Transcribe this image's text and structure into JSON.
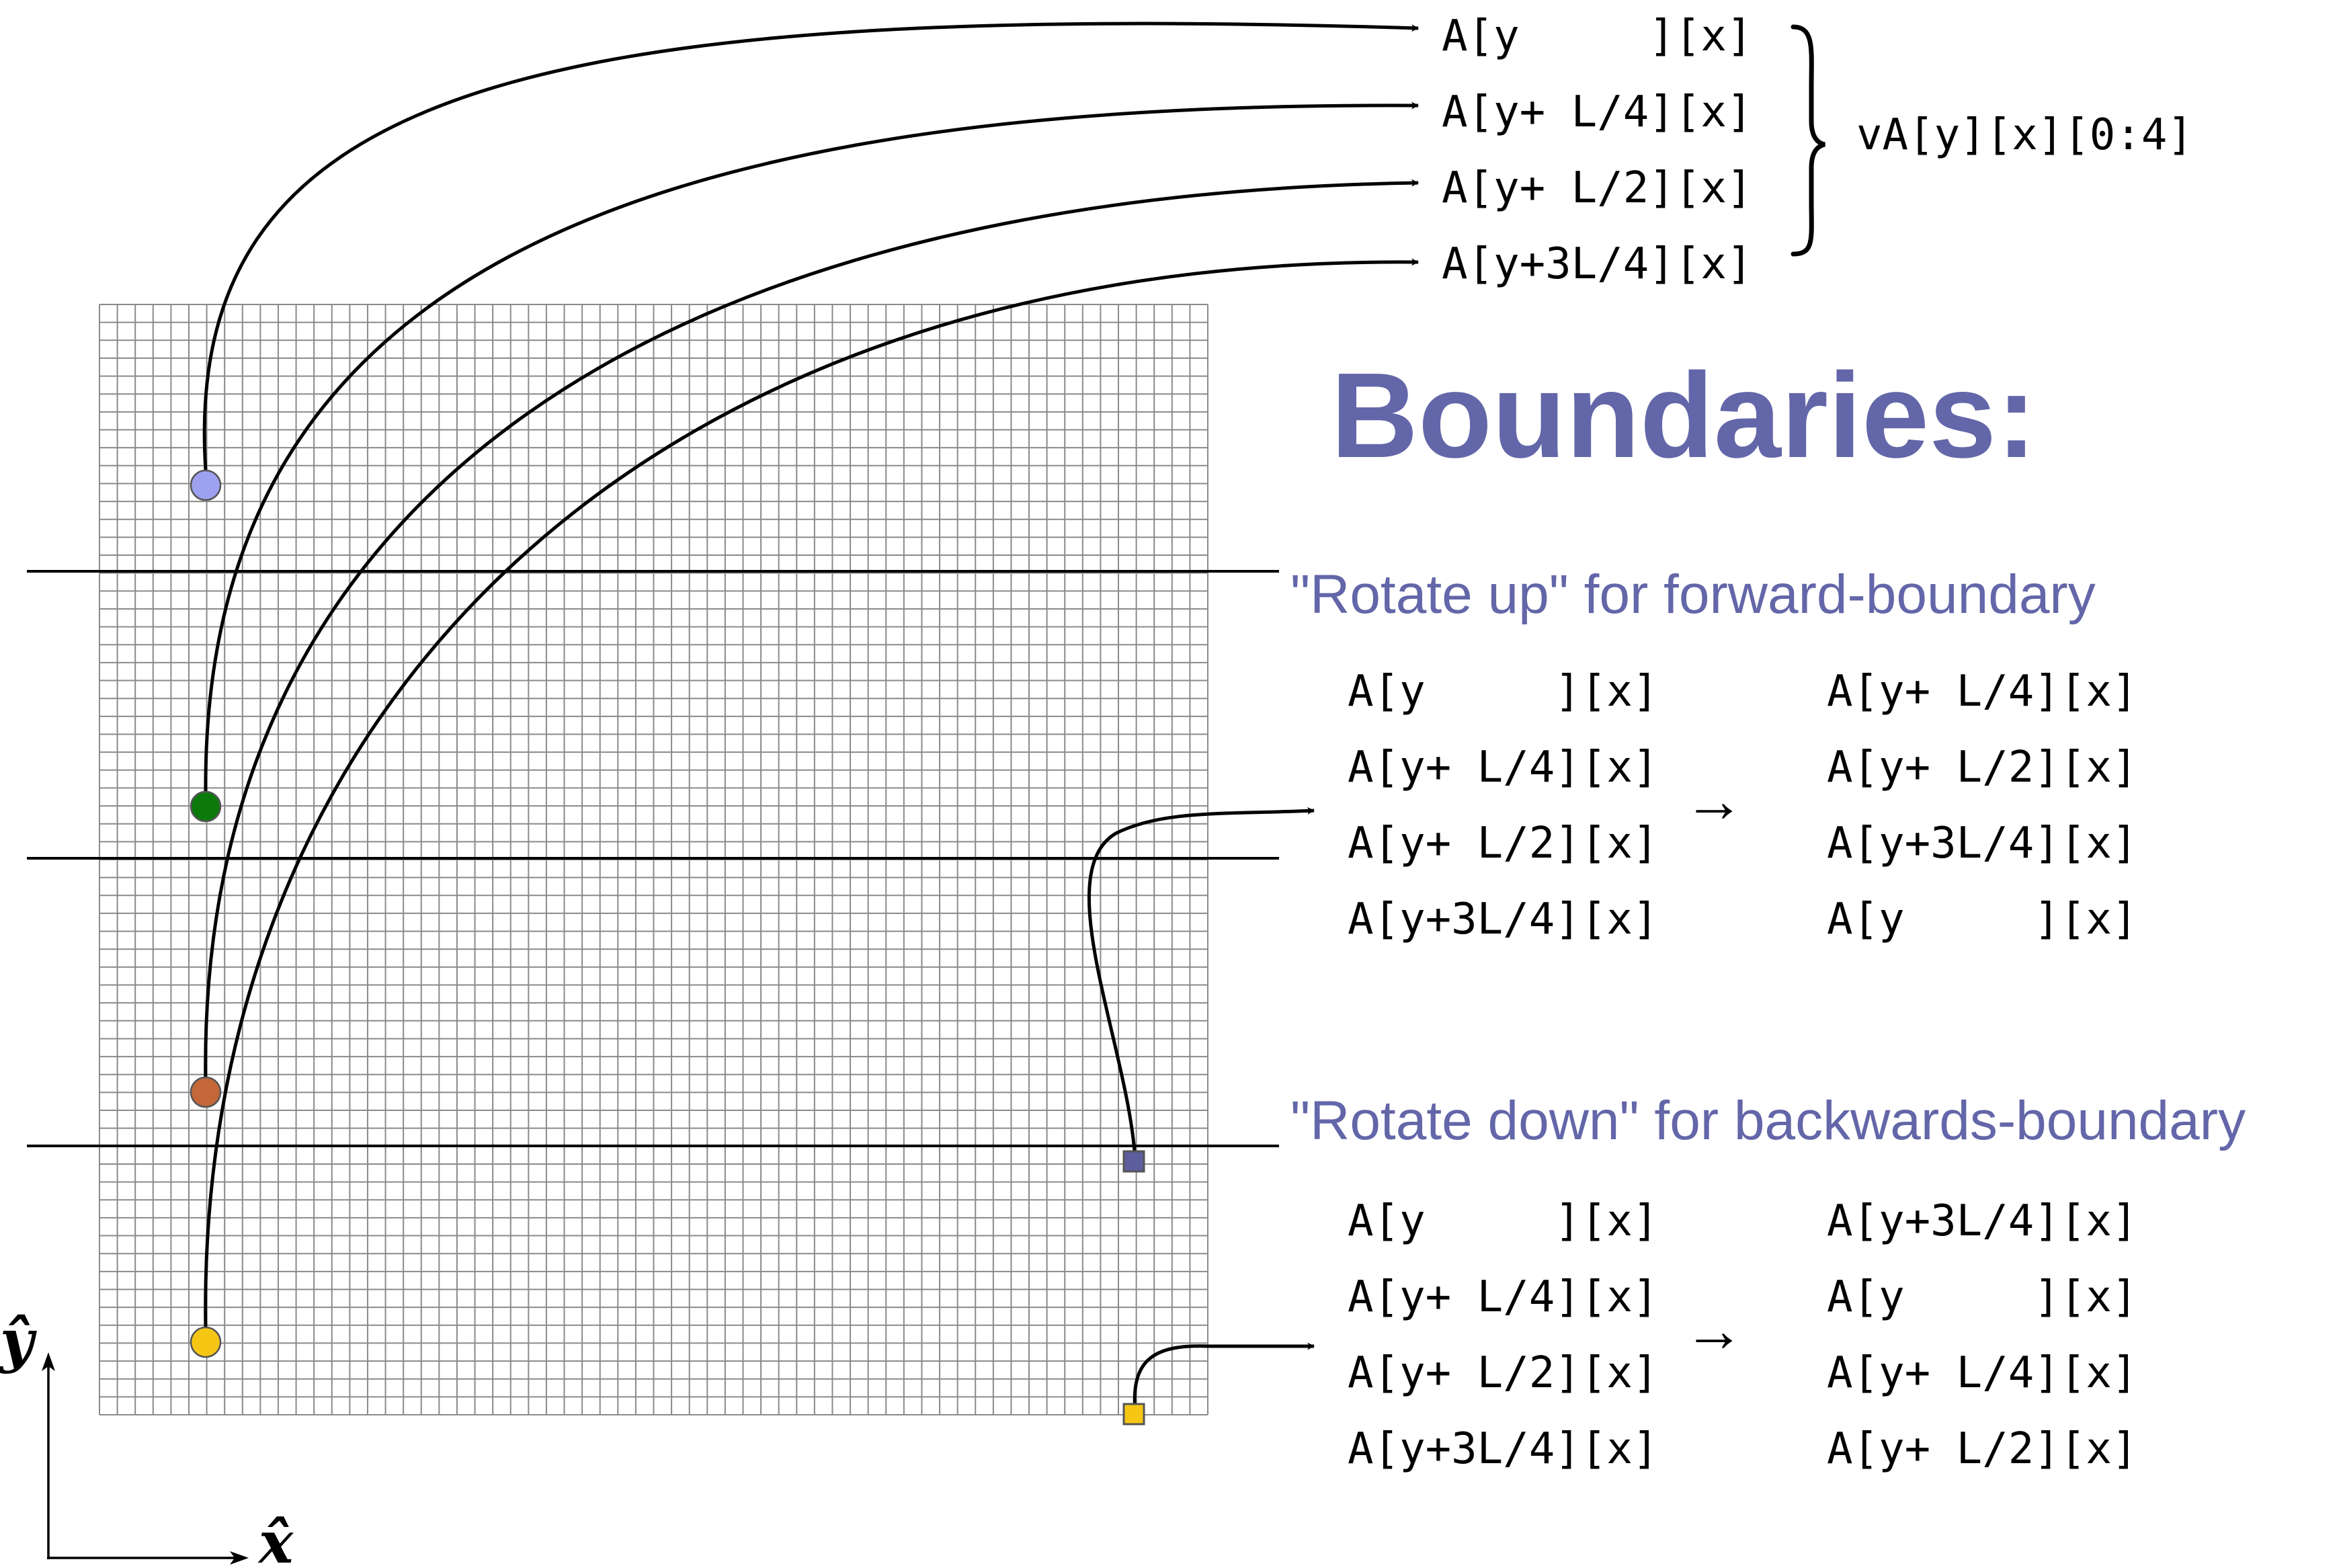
{
  "heading": "Boundaries:",
  "vector_label": "vA[y][x][0:4]",
  "stack_rows": [
    "A[y     ][x]",
    "A[y+ L/4][x]",
    "A[y+ L/2][x]",
    "A[y+3L/4][x]"
  ],
  "forward": {
    "title": "\"Rotate up\" for forward-boundary",
    "left": [
      "A[y     ][x]",
      "A[y+ L/4][x]",
      "A[y+ L/2][x]",
      "A[y+3L/4][x]"
    ],
    "arrow": "→",
    "right": [
      "A[y+ L/4][x]",
      "A[y+ L/2][x]",
      "A[y+3L/4][x]",
      "A[y     ][x]"
    ]
  },
  "backward": {
    "title": "\"Rotate down\" for backwards-boundary",
    "left": [
      "A[y     ][x]",
      "A[y+ L/4][x]",
      "A[y+ L/2][x]",
      "A[y+3L/4][x]"
    ],
    "arrow": "→",
    "right": [
      "A[y+3L/4][x]",
      "A[y     ][x]",
      "A[y+ L/4][x]",
      "A[y+ L/2][x]"
    ]
  },
  "axes": {
    "y": "ŷ",
    "x": "x̂"
  },
  "colors": {
    "heading": "#6366a8",
    "subtitle": "#6366a8",
    "grid": "#8a8a8a",
    "dot_lavender": "#9ea0f0",
    "dot_green": "#0b7a0b",
    "dot_orange": "#c4683a",
    "dot_yellow": "#f6c615",
    "square_purple": "#5c5e9e",
    "square_yellow": "#f6c615"
  }
}
